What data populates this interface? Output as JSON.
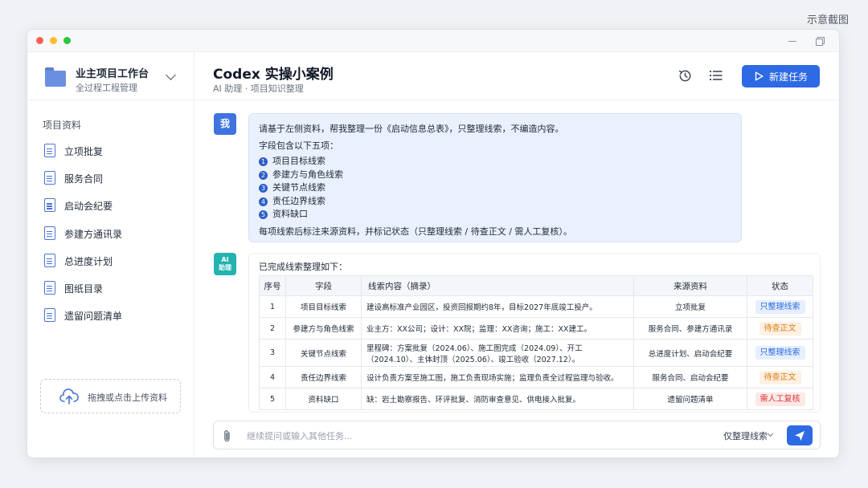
{
  "corner_note": "示意截图",
  "workspace": {
    "title": "业主项目工作台",
    "subtitle": "全过程工程管理"
  },
  "sidebar": {
    "section_title": "项目资料",
    "items": [
      {
        "label": "立项批复"
      },
      {
        "label": "服务合同"
      },
      {
        "label": "启动会纪要"
      },
      {
        "label": "参建方通讯录"
      },
      {
        "label": "总进度计划"
      },
      {
        "label": "图纸目录"
      },
      {
        "label": "遗留问题清单"
      }
    ],
    "upload_label": "拖拽或点击上传资料"
  },
  "header": {
    "title": "Codex 实操小案例",
    "subtitle": "AI 助理 · 项目知识整理",
    "new_task_label": "新建任务"
  },
  "user_message": {
    "avatar": "我",
    "line1": "请基于左侧资料，帮我整理一份《启动信息总表》，只整理线索，不编造内容。",
    "line2": "字段包含以下五项：",
    "items": [
      {
        "num": "1",
        "text": "项目目标线索"
      },
      {
        "num": "2",
        "text": "参建方与角色线索"
      },
      {
        "num": "3",
        "text": "关键节点线索"
      },
      {
        "num": "4",
        "text": "责任边界线索"
      },
      {
        "num": "5",
        "text": "资料缺口"
      }
    ],
    "line3": "每项线索后标注来源资料，并标记状态（只整理线索 / 待查正文 / 需人工复核）。"
  },
  "ai_message": {
    "avatar_line1": "AI",
    "avatar_line2": "助理",
    "intro": "已完成线索整理如下：",
    "columns": [
      "序号",
      "字段",
      "线索内容（摘录）",
      "来源资料",
      "状态"
    ],
    "rows": [
      {
        "no": "1",
        "field": "项目目标线索",
        "content": "建设高标准产业园区，投资回报期约8年，目标2027年底竣工投产。",
        "source": "立项批复",
        "status": "只整理线索",
        "status_type": "blue"
      },
      {
        "no": "2",
        "field": "参建方与角色线索",
        "content": "业主方：XX公司；设计：XX院；监理：XX咨询；施工：XX建工。",
        "source": "服务合同、参建方通讯录",
        "status": "待查正文",
        "status_type": "orange"
      },
      {
        "no": "3",
        "field": "关键节点线索",
        "content": "里程碑：方案批复（2024.06）、施工图完成（2024.09）、开工（2024.10）、主体封顶（2025.06）、竣工验收（2027.12）。",
        "source": "总进度计划、启动会纪要",
        "status": "只整理线索",
        "status_type": "blue"
      },
      {
        "no": "4",
        "field": "责任边界线索",
        "content": "设计负责方案至施工图，施工负责现场实施；监理负责全过程监理与验收。",
        "source": "服务合同、启动会纪要",
        "status": "待查正文",
        "status_type": "orange"
      },
      {
        "no": "5",
        "field": "资料缺口",
        "content": "缺：岩土勘察报告、环评批复、消防审查意见、供电接入批复。",
        "source": "遗留问题清单",
        "status": "需人工复核",
        "status_type": "red"
      }
    ]
  },
  "composer": {
    "placeholder": "继续提问或输入其他任务...",
    "mode": "仅整理线索"
  },
  "colors": {
    "accent": "#2d6ae3",
    "status_blue_bg": "#e6effd",
    "status_blue_fg": "#2d6ae3",
    "status_orange_bg": "#fdf1e3",
    "status_orange_fg": "#e07b12",
    "status_red_bg": "#fde8e8",
    "status_red_fg": "#d93636"
  },
  "icons": [
    "folder-icon",
    "chevron-down-icon",
    "document-icon",
    "upload-cloud-icon",
    "history-icon",
    "list-icon",
    "play-icon",
    "paperclip-icon",
    "send-icon"
  ]
}
